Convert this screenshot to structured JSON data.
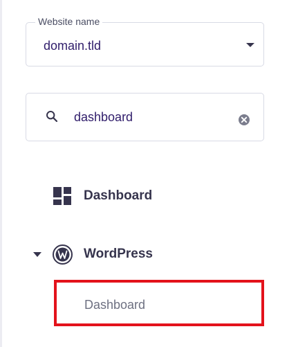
{
  "website_selector": {
    "label": "Website name",
    "value": "domain.tld",
    "icon": "chevron-down-icon"
  },
  "search": {
    "value": "dashboard",
    "icon": "search-icon",
    "clear_icon": "clear-icon"
  },
  "menu": {
    "dashboard": {
      "label": "Dashboard",
      "icon": "dashboard-grid-icon"
    },
    "wordpress": {
      "label": "WordPress",
      "icon": "wordpress-icon",
      "expanded": true,
      "children": [
        {
          "label": "Dashboard",
          "highlighted": true
        }
      ]
    }
  },
  "colors": {
    "text_dark": "#2f1c6a",
    "menu_text": "#36344d",
    "muted_text": "#6d7081",
    "border": "#d8dae5",
    "highlight_border": "#e3121b"
  }
}
